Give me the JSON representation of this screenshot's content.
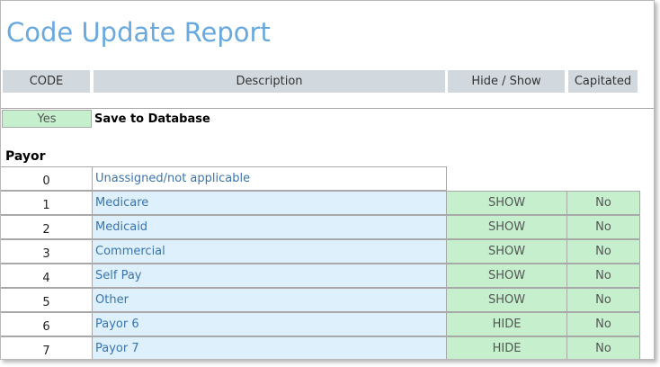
{
  "report": {
    "title": "Code Update Report",
    "columns": {
      "code": "CODE",
      "description": "Description",
      "hide_show": "Hide / Show",
      "capitated": "Capitated"
    },
    "save": {
      "value": "Yes",
      "label": "Save to Database"
    },
    "section": "Payor",
    "rows": [
      {
        "code": "0",
        "description": "Unassigned/not applicable",
        "hide_show": "",
        "capitated": ""
      },
      {
        "code": "1",
        "description": "Medicare",
        "hide_show": "SHOW",
        "capitated": "No"
      },
      {
        "code": "2",
        "description": "Medicaid",
        "hide_show": "SHOW",
        "capitated": "No"
      },
      {
        "code": "3",
        "description": "Commercial",
        "hide_show": "SHOW",
        "capitated": "No"
      },
      {
        "code": "4",
        "description": "Self Pay",
        "hide_show": "SHOW",
        "capitated": "No"
      },
      {
        "code": "5",
        "description": "Other",
        "hide_show": "SHOW",
        "capitated": "No"
      },
      {
        "code": "6",
        "description": "Payor 6",
        "hide_show": "HIDE",
        "capitated": "No"
      },
      {
        "code": "7",
        "description": "Payor 7",
        "hide_show": "HIDE",
        "capitated": "No"
      }
    ]
  },
  "colors": {
    "title": "#69a9de",
    "header_bg": "#d1d9de",
    "green_cell": "#c6efce",
    "blue_cell": "#ddf0fb"
  }
}
